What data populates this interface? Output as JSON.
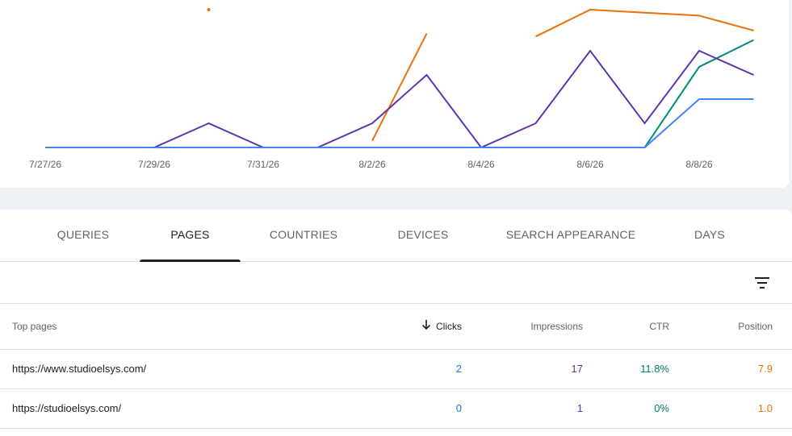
{
  "colors": {
    "clicks": "#4285f4",
    "impressions": "#5e35b1",
    "ctr": "#00897b",
    "position": "#e8710a"
  },
  "chart_data": {
    "type": "line",
    "x_tick_labels": [
      "7/27/26",
      "7/29/26",
      "7/31/26",
      "8/2/26",
      "8/4/26",
      "8/6/26",
      "8/8/26"
    ],
    "x": [
      "7/27/26",
      "7/28/26",
      "7/29/26",
      "7/30/26",
      "7/31/26",
      "8/1/26",
      "8/2/26",
      "8/3/26",
      "8/4/26",
      "8/5/26",
      "8/6/26",
      "8/7/26",
      "8/8/26",
      "8/9/26"
    ],
    "series": [
      {
        "key": "clicks",
        "values": [
          0,
          0,
          0,
          0,
          0,
          0,
          0,
          0,
          0,
          0,
          0,
          0,
          2,
          2
        ]
      },
      {
        "key": "impressions",
        "values": [
          0,
          0,
          0,
          1,
          0,
          0,
          1,
          3,
          0,
          1,
          4,
          1,
          4,
          3
        ]
      },
      {
        "key": "ctr",
        "values": [
          0,
          0,
          0,
          0,
          0,
          0,
          0,
          0,
          0,
          0,
          0,
          0,
          66.7,
          88.9
        ]
      },
      {
        "key": "position",
        "values": [
          null,
          null,
          null,
          1.0,
          null,
          null,
          45.0,
          9.0,
          null,
          10.0,
          1.0,
          2.0,
          3.0,
          8.0
        ]
      }
    ],
    "grid": false,
    "legend": "none"
  },
  "tabs": [
    {
      "label": "QUERIES"
    },
    {
      "label": "PAGES"
    },
    {
      "label": "COUNTRIES"
    },
    {
      "label": "DEVICES"
    },
    {
      "label": "SEARCH APPEARANCE"
    },
    {
      "label": "DAYS"
    }
  ],
  "active_tab": "PAGES",
  "filter_icon": "filter-list-icon",
  "table": {
    "headers": {
      "page": "Top pages",
      "clicks": "Clicks",
      "impressions": "Impressions",
      "ctr": "CTR",
      "position": "Position"
    },
    "sort_icon": "arrow-down-icon",
    "rows": [
      {
        "page": "https://www.studioelsys.com/",
        "clicks": "2",
        "impressions": "17",
        "ctr": "11.8%",
        "position": "7.9"
      },
      {
        "page": "https://studioelsys.com/",
        "clicks": "0",
        "impressions": "1",
        "ctr": "0%",
        "position": "1.0"
      }
    ]
  }
}
